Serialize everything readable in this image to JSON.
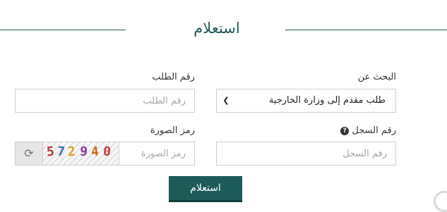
{
  "header": {
    "title": "استعلام"
  },
  "search_by": {
    "label": "البحث عن",
    "selected": "طلب مقدم إلى وزارة الخارجية"
  },
  "request_number": {
    "label": "رقم الطلب",
    "placeholder": "رقم الطلب"
  },
  "record_number": {
    "label": "رقم السجل",
    "placeholder": "رقم السجل",
    "help_icon": "question-circle-icon"
  },
  "captcha": {
    "label": "رمز الصورة",
    "placeholder": "رمز الصورة",
    "image_text": "572940",
    "refresh_icon": "refresh-icon"
  },
  "submit": {
    "label": "استعلام"
  },
  "colors": {
    "accent": "#1d5b59",
    "border": "#cfcfcf"
  }
}
